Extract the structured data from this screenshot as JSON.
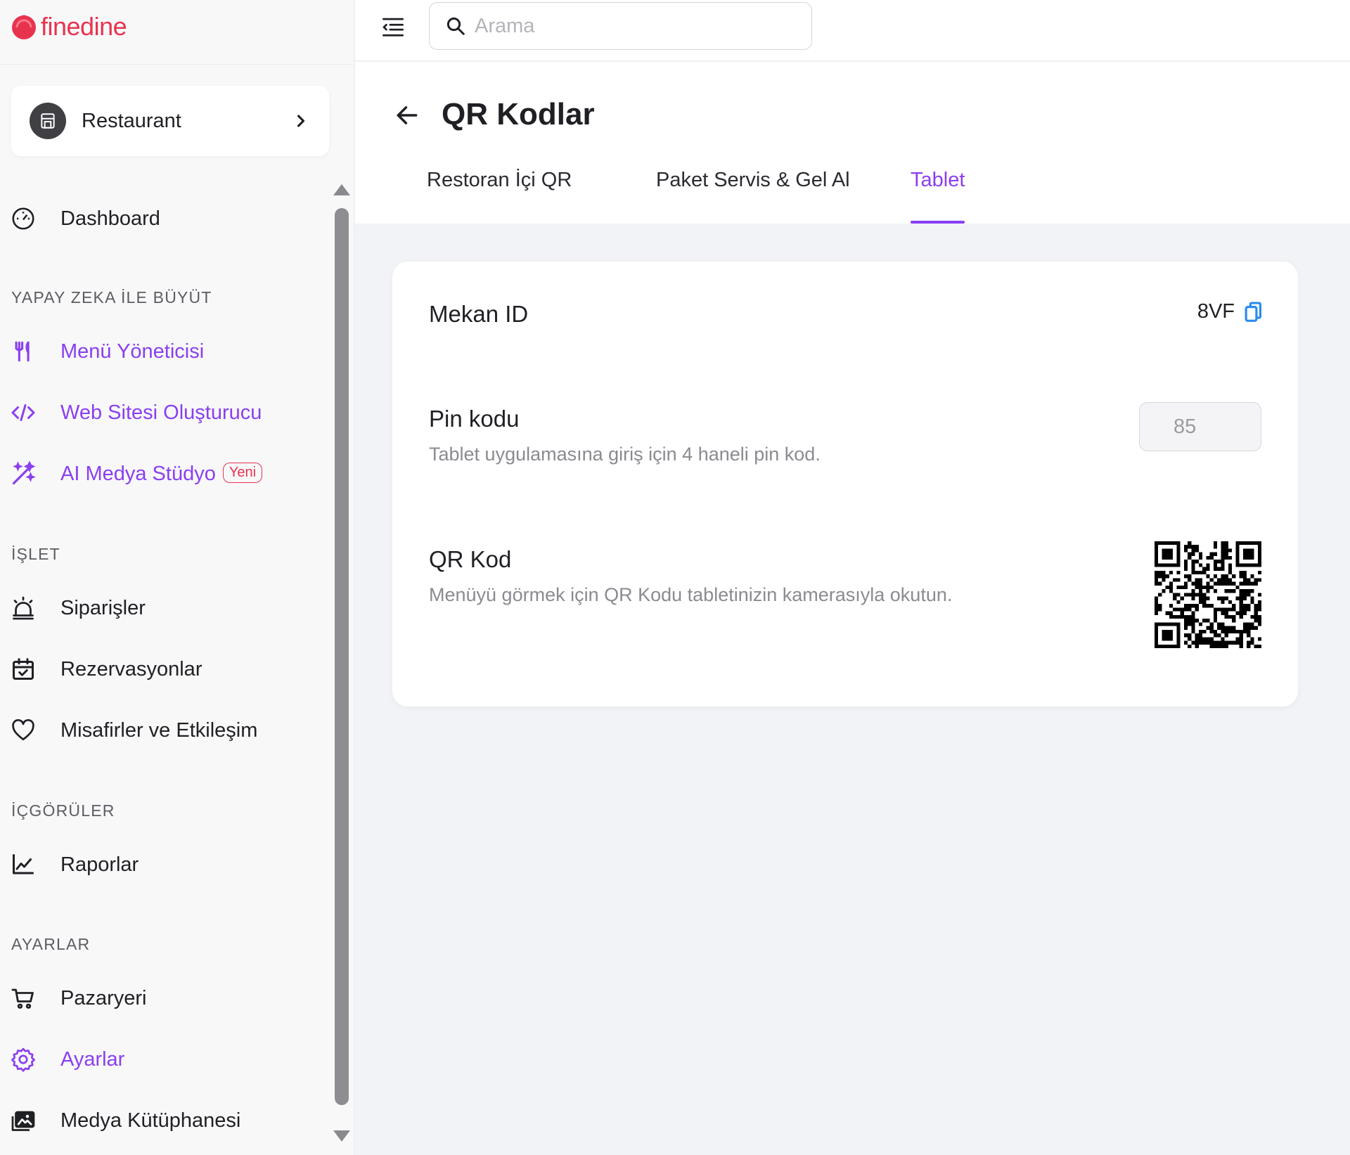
{
  "brand": {
    "name": "finedine",
    "color": "#e8334f"
  },
  "accent": "#8a3ff0",
  "venue": {
    "name": "Restaurant"
  },
  "search": {
    "placeholder": "Arama",
    "value": ""
  },
  "sidebar": {
    "dashboard": "Dashboard",
    "sections": {
      "ai": "YAPAY ZEKA İLE BÜYÜT",
      "operate": "İŞLET",
      "insights": "İÇGÖRÜLER",
      "settings": "AYARLAR"
    },
    "items": {
      "menu_manager": "Menü Yöneticisi",
      "website_builder": "Web Sitesi Oluşturucu",
      "ai_media": "AI Medya Stüdyo",
      "ai_media_badge": "Yeni",
      "orders": "Siparişler",
      "reservations": "Rezervasyonlar",
      "guests": "Misafirler ve Etkileşim",
      "reports": "Raporlar",
      "marketplace": "Pazaryeri",
      "settings": "Ayarlar",
      "media_library": "Medya Kütüphanesi"
    }
  },
  "page": {
    "title": "QR Kodlar",
    "tabs": [
      "Restoran İçi QR",
      "Paket Servis & Gel Al",
      "Tablet"
    ],
    "active_tab": "Tablet"
  },
  "card": {
    "venue_id_label": "Mekan ID",
    "venue_id_value": "8VF",
    "pin_label": "Pin kodu",
    "pin_desc": "Tablet uygulamasına giriş için 4 haneli pin kod.",
    "pin_value": "85",
    "qr_label": "QR Kod",
    "qr_desc": "Menüyü görmek için QR Kodu tabletinizin kamerasıyla okutun."
  },
  "icons": {
    "logo": "finedine-logo-icon",
    "venue": "store-icon",
    "chevron": "chevron-right-icon",
    "menu_toggle": "menu-collapse-icon",
    "search": "search-icon",
    "back": "arrow-left-icon",
    "copy": "copy-icon"
  }
}
